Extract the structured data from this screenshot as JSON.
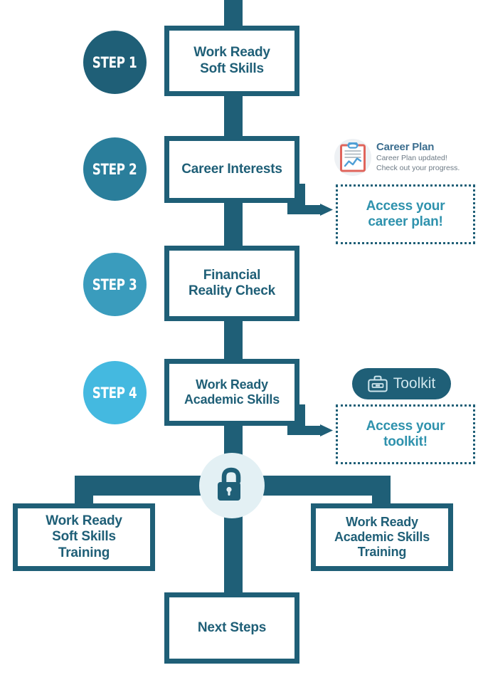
{
  "colors": {
    "teal_dark": "#1f5f77",
    "teal_mid": "#2f92ad",
    "teal_light": "#3fb5dd",
    "step1": "#1f5f77",
    "step2": "#2a7e9b",
    "step3": "#3a9cbd",
    "step4": "#44b9e0",
    "lock_circle": "#e3f0f4",
    "toolkit_pill": "#1f5f77",
    "toolkit_label": "#cfe6ed",
    "career_title": "#3c6e8f",
    "career_sub": "#6d7a85",
    "clipboard_red": "#e0645b",
    "clipboard_blue": "#4f9fd6",
    "white": "#ffffff"
  },
  "steps": [
    {
      "label": "STEP 1",
      "box": "Work Ready\nSoft Skills"
    },
    {
      "label": "STEP 2",
      "box": "Career Interests"
    },
    {
      "label": "STEP 3",
      "box": "Financial\nReality Check"
    },
    {
      "label": "STEP 4",
      "box": "Work Ready\nAcademic Skills"
    }
  ],
  "career_plan": {
    "icon": "clipboard-chart-icon",
    "title": "Career Plan",
    "subtitle": "Career Plan updated!\nCheck out your progress."
  },
  "access_career": {
    "text": "Access your\ncareer plan!"
  },
  "toolkit": {
    "icon": "toolbox-icon",
    "label": "Toolkit"
  },
  "access_toolkit": {
    "text": "Access your\ntoolkit!"
  },
  "lock": {
    "icon": "open-padlock-icon"
  },
  "outcomes": [
    {
      "text": "Work Ready\nSoft Skills\nTraining"
    },
    {
      "text": "Work Ready\nAcademic Skills\nTraining"
    }
  ],
  "final": {
    "text": "Next Steps"
  }
}
